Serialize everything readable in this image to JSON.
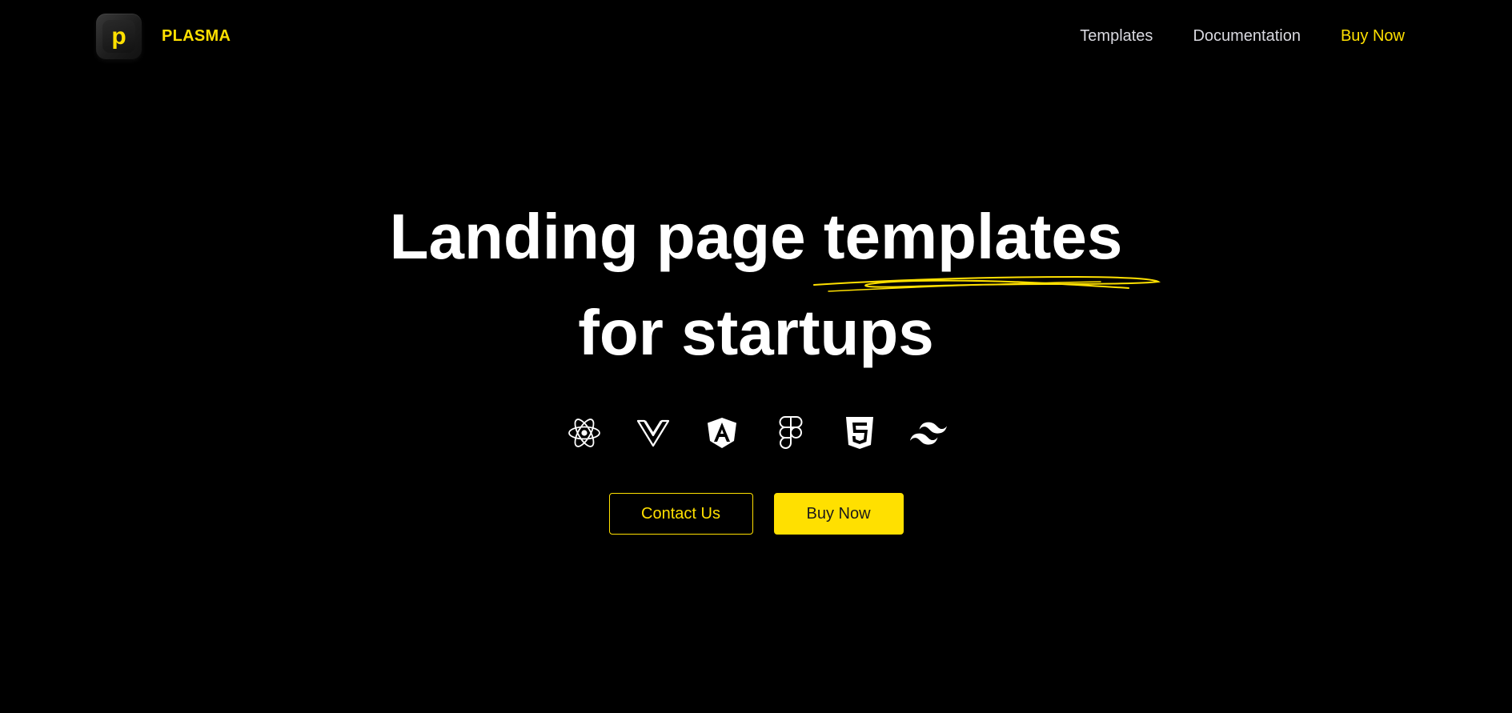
{
  "brand": {
    "logo_letter": "p",
    "name": "PLASMA",
    "accent_color": "#FFE000"
  },
  "nav": {
    "items": [
      {
        "label": "Templates"
      },
      {
        "label": "Documentation"
      },
      {
        "label": "Buy Now"
      }
    ]
  },
  "hero": {
    "title_line1": "Landing page templates",
    "title_line2": "for startups"
  },
  "tech_icons": [
    "react-icon",
    "vue-icon",
    "angular-icon",
    "figma-icon",
    "html5-icon",
    "tailwind-icon"
  ],
  "cta": {
    "contact_label": "Contact Us",
    "buy_label": "Buy Now"
  }
}
